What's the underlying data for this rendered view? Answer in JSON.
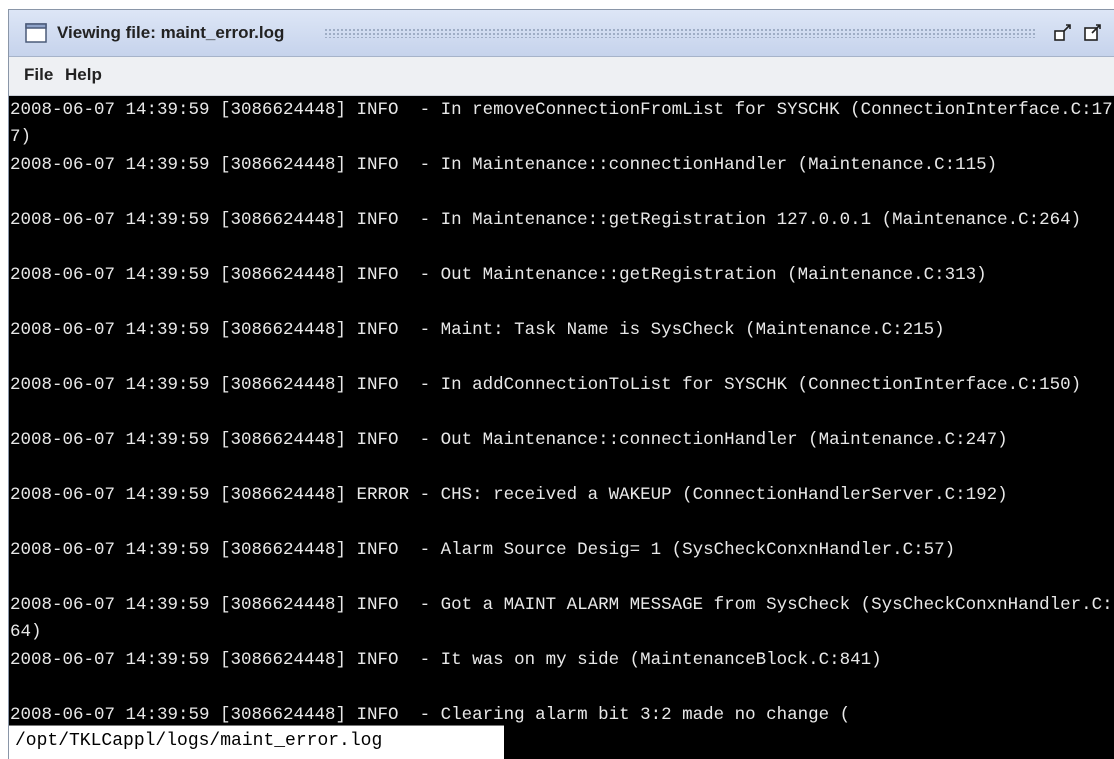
{
  "window": {
    "title": "Viewing file: maint_error.log",
    "controls": [
      "restore-icon",
      "maximize-icon"
    ]
  },
  "menu": {
    "items": [
      {
        "label": "File"
      },
      {
        "label": "Help"
      }
    ]
  },
  "log": {
    "lines": [
      "2008-06-07 14:39:59 [3086624448] INFO  - In removeConnectionFromList for SYSCHK (ConnectionInterface.C:177)",
      "2008-06-07 14:39:59 [3086624448] INFO  - In Maintenance::connectionHandler (Maintenance.C:115)",
      "2008-06-07 14:39:59 [3086624448] INFO  - In Maintenance::getRegistration 127.0.0.1 (Maintenance.C:264)",
      "2008-06-07 14:39:59 [3086624448] INFO  - Out Maintenance::getRegistration (Maintenance.C:313)",
      "2008-06-07 14:39:59 [3086624448] INFO  - Maint: Task Name is SysCheck (Maintenance.C:215)",
      "2008-06-07 14:39:59 [3086624448] INFO  - In addConnectionToList for SYSCHK (ConnectionInterface.C:150)",
      "2008-06-07 14:39:59 [3086624448] INFO  - Out Maintenance::connectionHandler (Maintenance.C:247)",
      "2008-06-07 14:39:59 [3086624448] ERROR - CHS: received a WAKEUP (ConnectionHandlerServer.C:192)",
      "2008-06-07 14:39:59 [3086624448] INFO  - Alarm Source Desig= 1 (SysCheckConxnHandler.C:57)",
      "2008-06-07 14:39:59 [3086624448] INFO  - Got a MAINT ALARM MESSAGE from SysCheck (SysCheckConxnHandler.C:64)",
      "2008-06-07 14:39:59 [3086624448] INFO  - It was on my side (MaintenanceBlock.C:841)",
      "2008-06-07 14:39:59 [3086624448] INFO  - Clearing alarm bit 3:2 made no change ("
    ]
  },
  "status": {
    "path": "/opt/TKLCappl/logs/maint_error.log"
  },
  "colors": {
    "console_bg": "#000000",
    "console_fg": "#e8e8e8",
    "titlebar": "#c6d3ec"
  }
}
